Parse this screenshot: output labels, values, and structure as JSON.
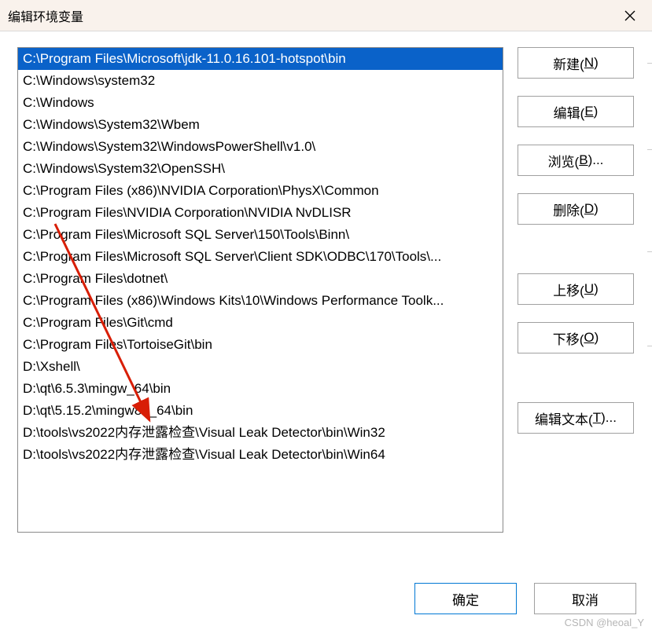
{
  "window": {
    "title": "编辑环境变量"
  },
  "list": {
    "items": [
      "C:\\Program Files\\Microsoft\\jdk-11.0.16.101-hotspot\\bin",
      "C:\\Windows\\system32",
      "C:\\Windows",
      "C:\\Windows\\System32\\Wbem",
      "C:\\Windows\\System32\\WindowsPowerShell\\v1.0\\",
      "C:\\Windows\\System32\\OpenSSH\\",
      "C:\\Program Files (x86)\\NVIDIA Corporation\\PhysX\\Common",
      "C:\\Program Files\\NVIDIA Corporation\\NVIDIA NvDLISR",
      "C:\\Program Files\\Microsoft SQL Server\\150\\Tools\\Binn\\",
      "C:\\Program Files\\Microsoft SQL Server\\Client SDK\\ODBC\\170\\Tools\\...",
      "C:\\Program Files\\dotnet\\",
      "C:\\Program Files (x86)\\Windows Kits\\10\\Windows Performance Toolk...",
      "C:\\Program Files\\Git\\cmd",
      "C:\\Program Files\\TortoiseGit\\bin",
      "D:\\Xshell\\",
      "D:\\qt\\6.5.3\\mingw_64\\bin",
      "D:\\qt\\5.15.2\\mingw81_64\\bin",
      "D:\\tools\\vs2022内存泄露检查\\Visual Leak Detector\\bin\\Win32",
      "D:\\tools\\vs2022内存泄露检查\\Visual Leak Detector\\bin\\Win64"
    ],
    "selected_index": 0
  },
  "buttons": {
    "new": "新建(",
    "new_key": "N",
    "edit": "编辑(",
    "edit_key": "E",
    "browse": "浏览(",
    "browse_key": "B",
    "browse_suffix": ")...",
    "delete": "删除(",
    "delete_key": "D",
    "move_up": "上移(",
    "move_up_key": "U",
    "move_down": "下移(",
    "move_down_key": "O",
    "edit_text": "编辑文本(",
    "edit_text_key": "T",
    "edit_text_suffix": ")...",
    "close_paren": ")",
    "ok": "确定",
    "cancel": "取消"
  },
  "watermark": "CSDN @heoal_Y"
}
